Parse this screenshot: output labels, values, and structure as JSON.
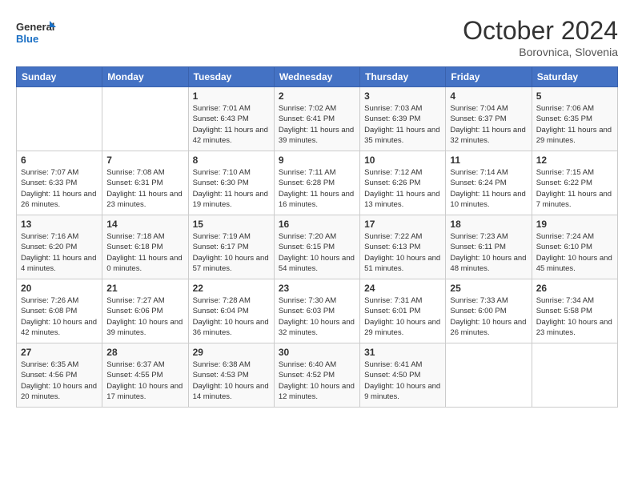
{
  "header": {
    "logo_general": "General",
    "logo_blue": "Blue",
    "month": "October 2024",
    "location": "Borovnica, Slovenia"
  },
  "weekdays": [
    "Sunday",
    "Monday",
    "Tuesday",
    "Wednesday",
    "Thursday",
    "Friday",
    "Saturday"
  ],
  "weeks": [
    [
      {
        "day": "",
        "info": ""
      },
      {
        "day": "",
        "info": ""
      },
      {
        "day": "1",
        "info": "Sunrise: 7:01 AM\nSunset: 6:43 PM\nDaylight: 11 hours and 42 minutes."
      },
      {
        "day": "2",
        "info": "Sunrise: 7:02 AM\nSunset: 6:41 PM\nDaylight: 11 hours and 39 minutes."
      },
      {
        "day": "3",
        "info": "Sunrise: 7:03 AM\nSunset: 6:39 PM\nDaylight: 11 hours and 35 minutes."
      },
      {
        "day": "4",
        "info": "Sunrise: 7:04 AM\nSunset: 6:37 PM\nDaylight: 11 hours and 32 minutes."
      },
      {
        "day": "5",
        "info": "Sunrise: 7:06 AM\nSunset: 6:35 PM\nDaylight: 11 hours and 29 minutes."
      }
    ],
    [
      {
        "day": "6",
        "info": "Sunrise: 7:07 AM\nSunset: 6:33 PM\nDaylight: 11 hours and 26 minutes."
      },
      {
        "day": "7",
        "info": "Sunrise: 7:08 AM\nSunset: 6:31 PM\nDaylight: 11 hours and 23 minutes."
      },
      {
        "day": "8",
        "info": "Sunrise: 7:10 AM\nSunset: 6:30 PM\nDaylight: 11 hours and 19 minutes."
      },
      {
        "day": "9",
        "info": "Sunrise: 7:11 AM\nSunset: 6:28 PM\nDaylight: 11 hours and 16 minutes."
      },
      {
        "day": "10",
        "info": "Sunrise: 7:12 AM\nSunset: 6:26 PM\nDaylight: 11 hours and 13 minutes."
      },
      {
        "day": "11",
        "info": "Sunrise: 7:14 AM\nSunset: 6:24 PM\nDaylight: 11 hours and 10 minutes."
      },
      {
        "day": "12",
        "info": "Sunrise: 7:15 AM\nSunset: 6:22 PM\nDaylight: 11 hours and 7 minutes."
      }
    ],
    [
      {
        "day": "13",
        "info": "Sunrise: 7:16 AM\nSunset: 6:20 PM\nDaylight: 11 hours and 4 minutes."
      },
      {
        "day": "14",
        "info": "Sunrise: 7:18 AM\nSunset: 6:18 PM\nDaylight: 11 hours and 0 minutes."
      },
      {
        "day": "15",
        "info": "Sunrise: 7:19 AM\nSunset: 6:17 PM\nDaylight: 10 hours and 57 minutes."
      },
      {
        "day": "16",
        "info": "Sunrise: 7:20 AM\nSunset: 6:15 PM\nDaylight: 10 hours and 54 minutes."
      },
      {
        "day": "17",
        "info": "Sunrise: 7:22 AM\nSunset: 6:13 PM\nDaylight: 10 hours and 51 minutes."
      },
      {
        "day": "18",
        "info": "Sunrise: 7:23 AM\nSunset: 6:11 PM\nDaylight: 10 hours and 48 minutes."
      },
      {
        "day": "19",
        "info": "Sunrise: 7:24 AM\nSunset: 6:10 PM\nDaylight: 10 hours and 45 minutes."
      }
    ],
    [
      {
        "day": "20",
        "info": "Sunrise: 7:26 AM\nSunset: 6:08 PM\nDaylight: 10 hours and 42 minutes."
      },
      {
        "day": "21",
        "info": "Sunrise: 7:27 AM\nSunset: 6:06 PM\nDaylight: 10 hours and 39 minutes."
      },
      {
        "day": "22",
        "info": "Sunrise: 7:28 AM\nSunset: 6:04 PM\nDaylight: 10 hours and 36 minutes."
      },
      {
        "day": "23",
        "info": "Sunrise: 7:30 AM\nSunset: 6:03 PM\nDaylight: 10 hours and 32 minutes."
      },
      {
        "day": "24",
        "info": "Sunrise: 7:31 AM\nSunset: 6:01 PM\nDaylight: 10 hours and 29 minutes."
      },
      {
        "day": "25",
        "info": "Sunrise: 7:33 AM\nSunset: 6:00 PM\nDaylight: 10 hours and 26 minutes."
      },
      {
        "day": "26",
        "info": "Sunrise: 7:34 AM\nSunset: 5:58 PM\nDaylight: 10 hours and 23 minutes."
      }
    ],
    [
      {
        "day": "27",
        "info": "Sunrise: 6:35 AM\nSunset: 4:56 PM\nDaylight: 10 hours and 20 minutes."
      },
      {
        "day": "28",
        "info": "Sunrise: 6:37 AM\nSunset: 4:55 PM\nDaylight: 10 hours and 17 minutes."
      },
      {
        "day": "29",
        "info": "Sunrise: 6:38 AM\nSunset: 4:53 PM\nDaylight: 10 hours and 14 minutes."
      },
      {
        "day": "30",
        "info": "Sunrise: 6:40 AM\nSunset: 4:52 PM\nDaylight: 10 hours and 12 minutes."
      },
      {
        "day": "31",
        "info": "Sunrise: 6:41 AM\nSunset: 4:50 PM\nDaylight: 10 hours and 9 minutes."
      },
      {
        "day": "",
        "info": ""
      },
      {
        "day": "",
        "info": ""
      }
    ]
  ]
}
